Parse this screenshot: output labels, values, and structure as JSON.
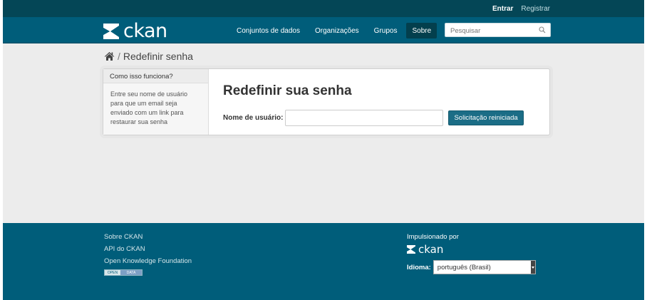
{
  "account": {
    "login": "Entrar",
    "register": "Registrar"
  },
  "masthead": {
    "logo_text": "ckan",
    "nav": [
      {
        "label": "Conjuntos de dados",
        "active": false
      },
      {
        "label": "Organizações",
        "active": false
      },
      {
        "label": "Grupos",
        "active": false
      },
      {
        "label": "Sobre",
        "active": true
      }
    ],
    "search": {
      "placeholder": "Pesquisar"
    }
  },
  "breadcrumb": {
    "current": "Redefinir senha"
  },
  "sidebar": {
    "title": "Como isso funciona?",
    "text": "Entre seu nome de usuário para que um email seja enviado com um link para restaurar sua senha"
  },
  "main": {
    "title": "Redefinir sua senha",
    "username_label": "Nome de usuário:",
    "username_value": "",
    "submit_label": "Solicitação reiniciada"
  },
  "footer": {
    "links": [
      "Sobre CKAN",
      "API do CKAN",
      "Open Knowledge Foundation"
    ],
    "open_data_badge": {
      "left": "OPEN",
      "right": "DATA"
    },
    "powered_by": "Impulsionado por",
    "powered_logo": "ckan",
    "language_label": "Idioma:",
    "language_selected": "português (Brasil)"
  },
  "colors": {
    "masthead": "#005d7a",
    "account_bar": "#044656",
    "button": "#1b6d86",
    "background": "#ececec"
  }
}
